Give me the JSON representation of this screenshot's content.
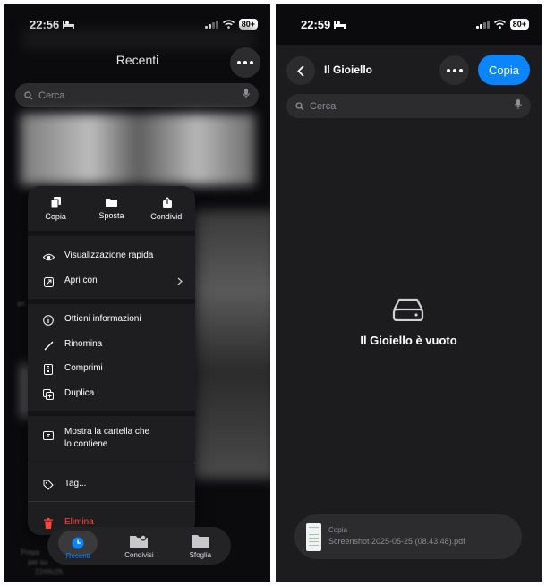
{
  "left": {
    "status": {
      "time": "22:56",
      "battery": "80+"
    },
    "title": "Recenti",
    "search_placeholder": "Cerca",
    "menu": {
      "top_actions": [
        {
          "label": "Copia",
          "icon": "doc-copy-icon"
        },
        {
          "label": "Sposta",
          "icon": "folder-icon"
        },
        {
          "label": "Condividi",
          "icon": "share-icon"
        }
      ],
      "quick_look": "Visualizzazione rapida",
      "open_with": "Apri con",
      "get_info": "Ottieni informazioni",
      "rename": "Rinomina",
      "compress": "Comprimi",
      "duplicate": "Duplica",
      "show_folder_1": "Mostra la cartella che",
      "show_folder_2": "lo contiene",
      "tags": "Tag...",
      "delete": "Elimina",
      "delete_color": "#ff453a"
    },
    "tabs": [
      {
        "label": "Recenti",
        "icon": "clock-icon",
        "active": true
      },
      {
        "label": "Condivisi",
        "icon": "shared-folder-icon",
        "active": false
      },
      {
        "label": "Sfoglia",
        "icon": "folder-icon",
        "active": false
      }
    ],
    "background_fragments": {
      "frag_an": "an",
      "frag_prep": "Prepa",
      "frag_per": "per su",
      "frag_date": "22/05/25"
    }
  },
  "right": {
    "status": {
      "time": "22:59",
      "battery": "80+"
    },
    "title": "Il Gioiello",
    "copy_button": "Copia",
    "search_placeholder": "Cerca",
    "empty_message": "Il Gioiello è vuoto",
    "pending_file": {
      "action": "Copia",
      "name": "Screenshot 2025-05-25 (08.43.48).pdf"
    }
  },
  "accent": "#0a84ff"
}
